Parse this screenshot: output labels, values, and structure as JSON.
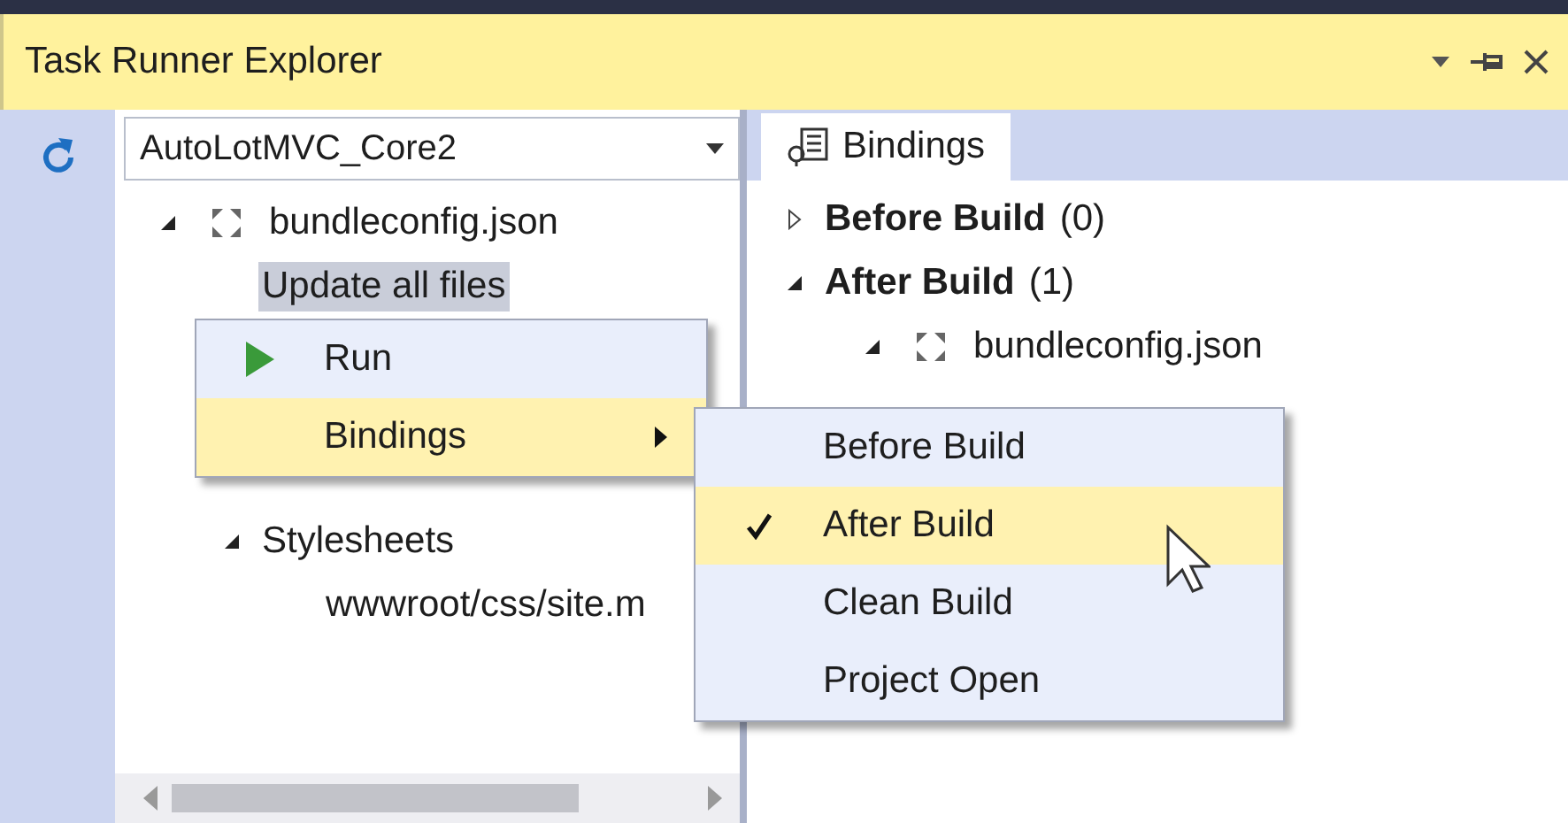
{
  "window": {
    "title": "Task Runner Explorer"
  },
  "project_selector": {
    "value": "AutoLotMVC_Core2"
  },
  "task_tree": [
    {
      "label": "bundleconfig.json",
      "kind": "file",
      "expanded": true,
      "selected": false,
      "children": [
        {
          "label": "Update all files",
          "selected": true
        },
        {
          "label": "Stylesheets",
          "expanded": true,
          "selected": false,
          "children": [
            {
              "label": "wwwroot/css/site.m",
              "selected": false
            }
          ]
        }
      ]
    }
  ],
  "tabs": [
    {
      "label": "Bindings",
      "selected": true
    }
  ],
  "bindings_tree": [
    {
      "label": "Before Build",
      "count": "(0)",
      "kind": "event",
      "expanded": false
    },
    {
      "label": "After Build",
      "count": "(1)",
      "kind": "event",
      "expanded": true,
      "children": [
        {
          "label": "bundleconfig.json",
          "kind": "file",
          "expanded": true
        }
      ]
    }
  ],
  "context_menu": [
    {
      "label": "Run",
      "kind": "run",
      "selected": false
    },
    {
      "label": "Bindings",
      "kind": "submenu",
      "selected": true
    }
  ],
  "submenu": [
    {
      "label": "Before Build",
      "checked": false,
      "selected": false
    },
    {
      "label": "After Build",
      "checked": true,
      "selected": true
    },
    {
      "label": "Clean Build",
      "checked": false,
      "selected": false
    },
    {
      "label": "Project Open",
      "checked": false,
      "selected": false
    }
  ]
}
